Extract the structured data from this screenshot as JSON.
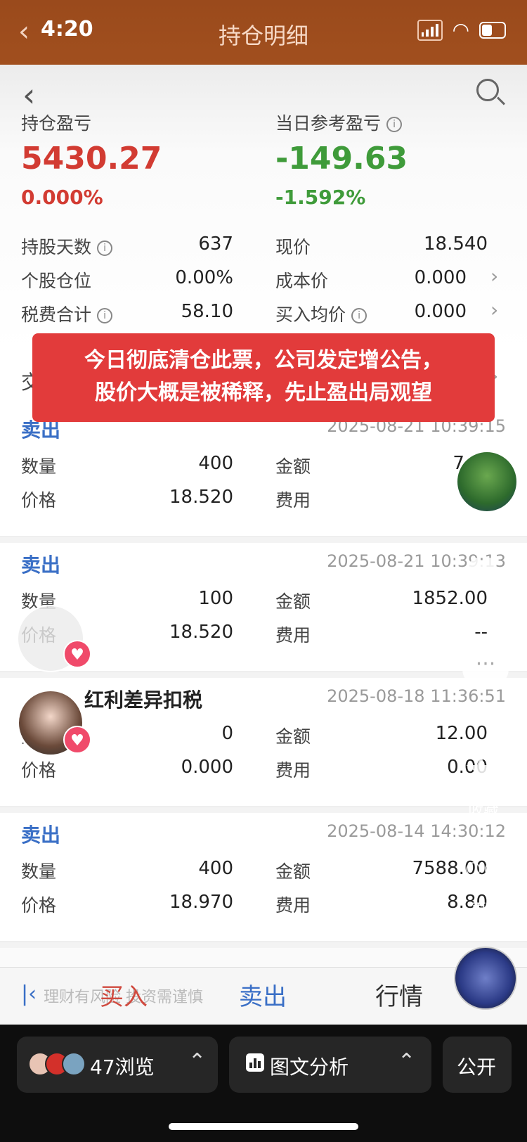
{
  "status_bar": {
    "time": "4:20",
    "signal_icon": "signal-icon",
    "wifi_icon": "wifi-icon",
    "battery_icon": "battery-icon"
  },
  "header": {
    "title": "持仓明细",
    "back_icon": "chevron-left-icon"
  },
  "summary": {
    "position_pl_label": "持仓盈亏",
    "position_pl_value": "5430.27",
    "position_pl_pct": "0.000%",
    "daily_pl_label": "当日参考盈亏",
    "daily_pl_value": "-149.63",
    "daily_pl_pct": "-1.592%",
    "rows": [
      {
        "left_label": "持股天数",
        "left_value": "637",
        "right_label": "现价",
        "right_value": "18.540"
      },
      {
        "left_label": "个股仓位",
        "left_value": "0.00%",
        "right_label": "成本价",
        "right_value": "0.000"
      },
      {
        "left_label": "税费合计",
        "left_value": "58.10",
        "right_label": "买入均价",
        "right_value": "0.000"
      }
    ]
  },
  "caption": {
    "line1": "今日彻底清仓此票，公司发定增公告，",
    "line2": "股价大概是被稀释，先止盈出局观望"
  },
  "trades_section_label": "交",
  "trades": [
    {
      "type": "卖出",
      "time": "2025-08-21 10:39:15",
      "qty_label": "数量",
      "qty": "400",
      "amount_label": "金额",
      "amount": "740",
      "price_label": "价格",
      "price": "18.520",
      "fee_label": "费用",
      "fee": "--"
    },
    {
      "type": "卖出",
      "time": "2025-08-21 10:39:13",
      "qty_label": "数量",
      "qty": "100",
      "amount_label": "金额",
      "amount": "1852.00",
      "price_label": "价格",
      "price": "18.520",
      "fee_label": "费用",
      "fee": "--"
    },
    {
      "type": "红利差异扣税",
      "time": "2025-08-18 11:36:51",
      "qty_label": "数量",
      "qty": "0",
      "amount_label": "金额",
      "amount": "12.00",
      "price_label": "价格",
      "price": "0.000",
      "fee_label": "费用",
      "fee": "0.00"
    },
    {
      "type": "卖出",
      "time": "2025-08-14 14:30:12",
      "qty_label": "数量",
      "qty": "400",
      "amount_label": "金额",
      "amount": "7588.00",
      "price_label": "价格",
      "price": "18.970",
      "fee_label": "费用",
      "fee": "8.80"
    }
  ],
  "order_bar": {
    "risk_text": "理财有风险 投资需谨慎",
    "buy": "买入",
    "sell": "卖出",
    "quote": "行情"
  },
  "side_actions": {
    "comment": "评论",
    "favorite": "收藏",
    "more": "更多"
  },
  "bottom_bar": {
    "views": "47浏览",
    "analysis": "图文分析",
    "public": "公开"
  },
  "colors": {
    "header_bg": "#a14f1e",
    "profit_red": "#d23b32",
    "loss_green": "#3f9b3a",
    "sell_blue": "#3a6fc6",
    "caption_bg": "#e23b3b"
  }
}
